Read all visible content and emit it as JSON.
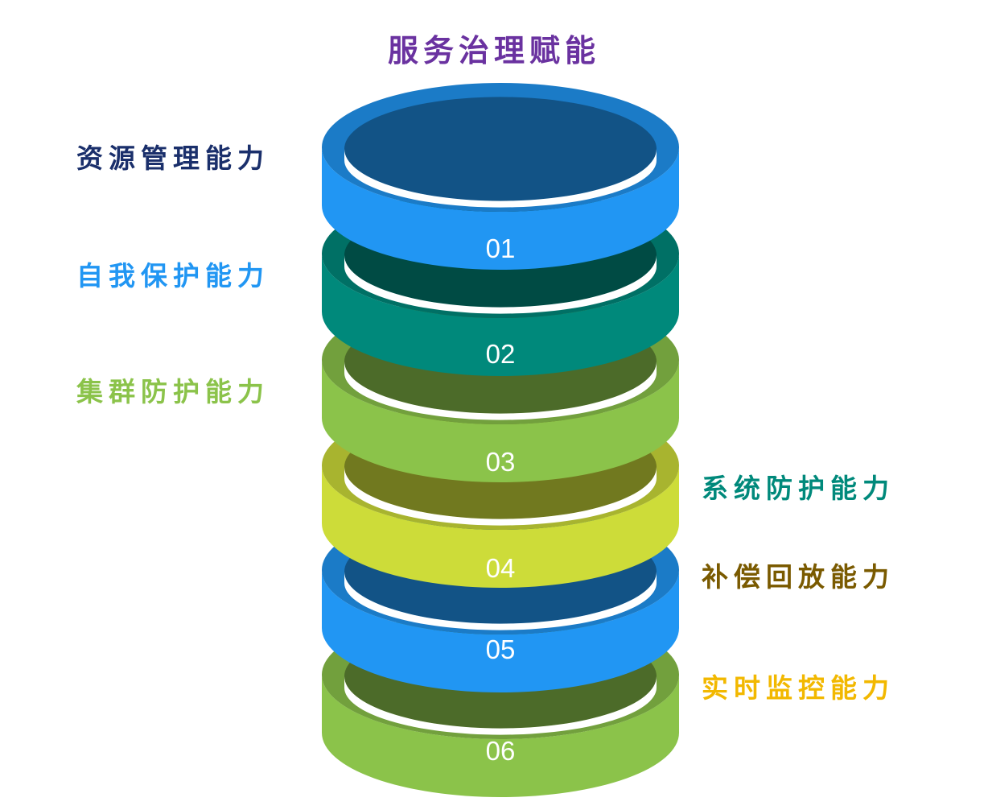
{
  "title": "服务治理赋能",
  "rings": [
    {
      "number": "01",
      "label": "资源管理能力",
      "label_color": "#1a2f6b",
      "ring_color": "#2196f3"
    },
    {
      "number": "02",
      "label": "自我保护能力",
      "label_color": "#2196f3",
      "ring_color": "#00897b"
    },
    {
      "number": "03",
      "label": "集群防护能力",
      "label_color": "#8bc34a",
      "ring_color": "#8bc34a"
    },
    {
      "number": "04",
      "label": "系统防护能力",
      "label_color": "#00897b",
      "ring_color": "#cddc39"
    },
    {
      "number": "05",
      "label": "补偿回放能力",
      "label_color": "#7a5a00",
      "ring_color": "#2196f3"
    },
    {
      "number": "06",
      "label": "实时监控能力",
      "label_color": "#f2b800",
      "ring_color": "#8bc34a"
    }
  ]
}
